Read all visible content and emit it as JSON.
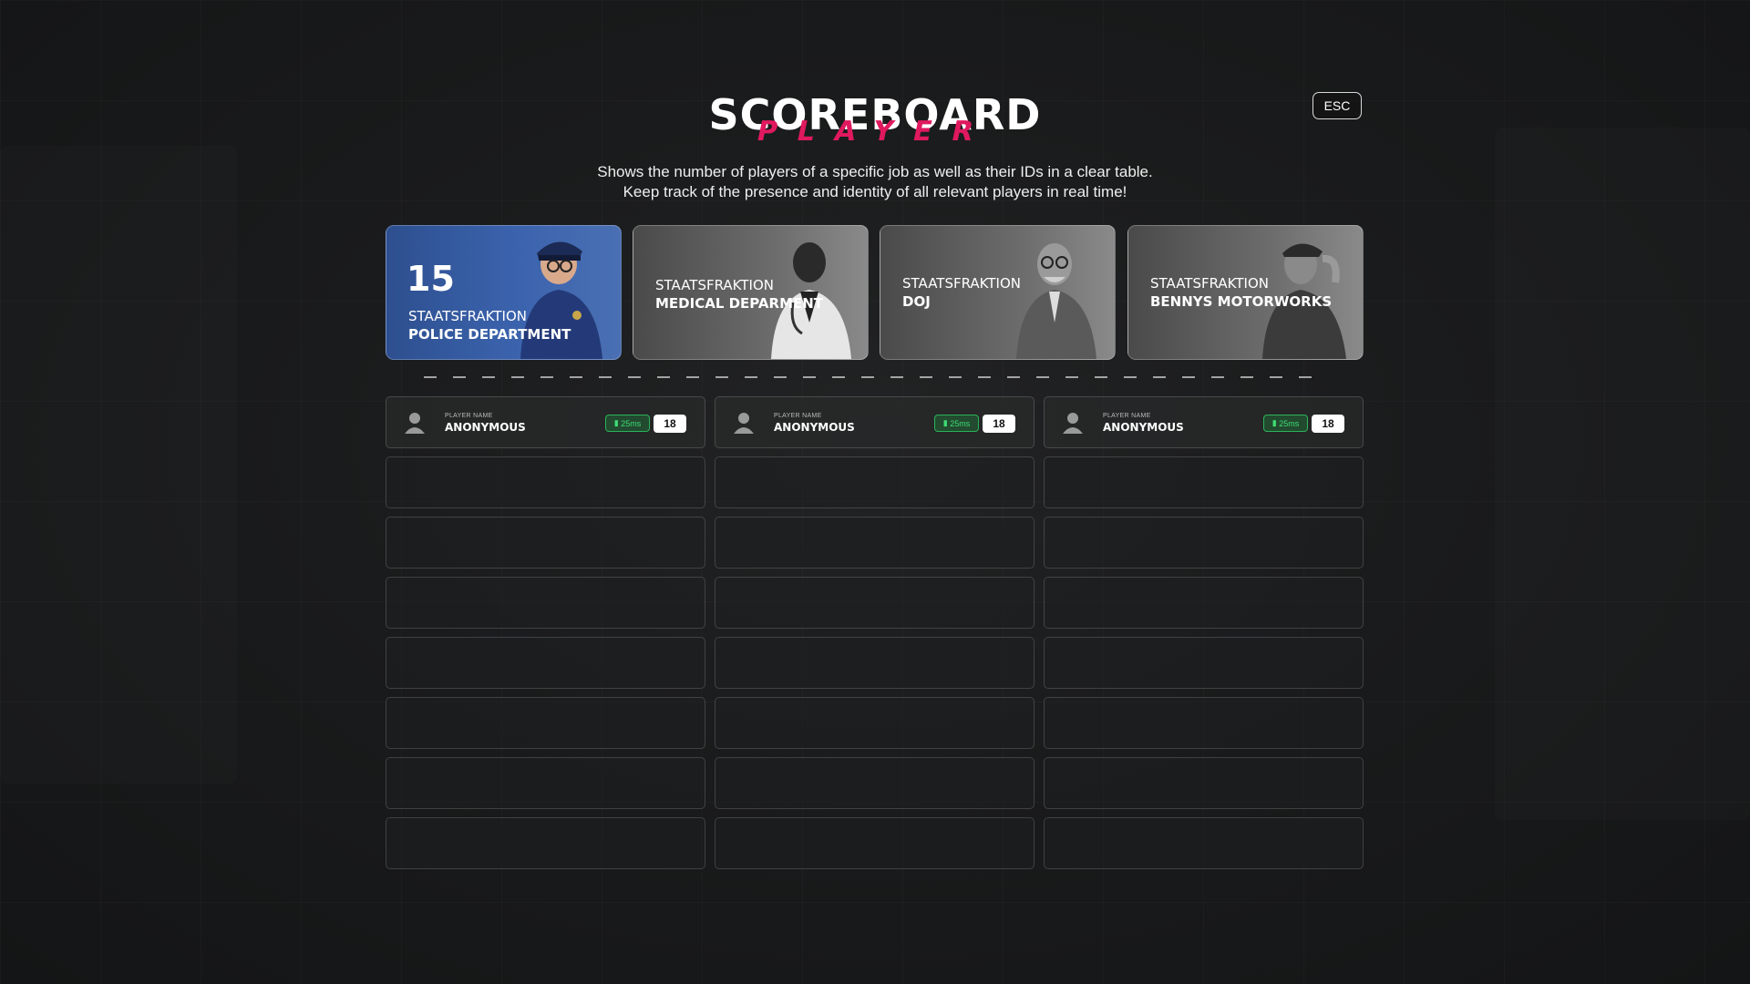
{
  "header": {
    "title": "SCOREBOARD",
    "subtitle": "PLAYER",
    "desc_line1": "Shows the number of players of a specific job as well as their IDs in a clear table.",
    "desc_line2": "Keep track of the presence and identity of all relevant players in real time!",
    "esc_label": "ESC"
  },
  "colors": {
    "accent": "#e0195f",
    "active_card": "#3b63ad",
    "ping_green": "#3fdc74"
  },
  "factions": [
    {
      "count": "15",
      "line1": "STAATSFRAKTION",
      "line2": "POLICE DEPARTMENT",
      "active": true,
      "icon": "police-officer-icon"
    },
    {
      "count": "",
      "line1": "STAATSFRAKTION",
      "line2": "MEDICAL DEPARMENT",
      "active": false,
      "icon": "doctor-icon"
    },
    {
      "count": "",
      "line1": "STAATSFRAKTION",
      "line2": "DOJ",
      "active": false,
      "icon": "judge-icon"
    },
    {
      "count": "",
      "line1": "STAATSFRAKTION",
      "line2": "BENNYS MOTORWORKS",
      "active": false,
      "icon": "mechanic-icon"
    }
  ],
  "players": [
    {
      "label": "PLAYER NAME",
      "name": "ANONYMOUS",
      "ping": "25ms",
      "id": "18"
    },
    {
      "label": "PLAYER NAME",
      "name": "ANONYMOUS",
      "ping": "25ms",
      "id": "18"
    },
    {
      "label": "PLAYER NAME",
      "name": "ANONYMOUS",
      "ping": "25ms",
      "id": "18"
    }
  ]
}
